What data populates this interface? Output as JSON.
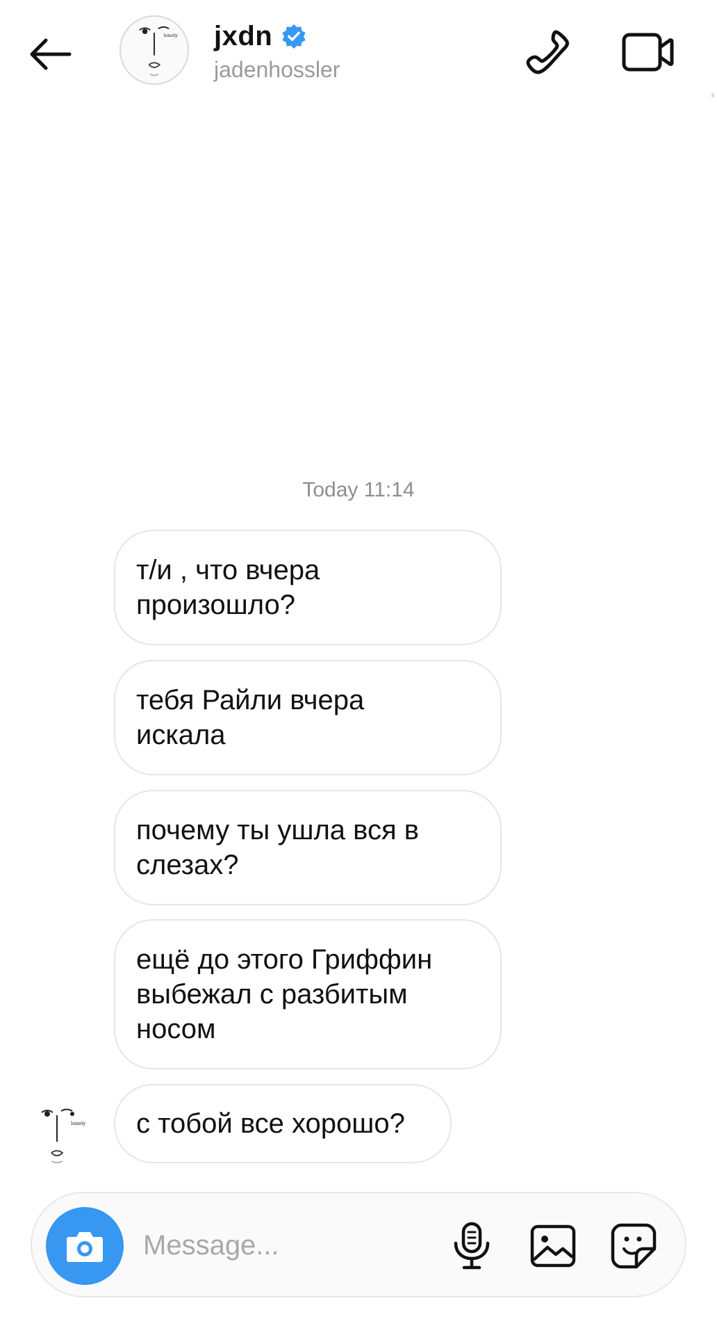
{
  "header": {
    "display_name": "jxdn",
    "username": "jadenhossler",
    "verified": true,
    "back_icon": "arrow-left-icon",
    "call_icon": "phone-icon",
    "video_icon": "video-camera-icon",
    "avatar_caption": "lonely"
  },
  "conversation": {
    "timestamp": "Today 11:14",
    "messages": [
      {
        "text_lines": [
          "т/и , что вчера",
          "произошло?"
        ]
      },
      {
        "text_lines": [
          "тебя Райли вчера",
          "искала"
        ]
      },
      {
        "text_lines": [
          "почему ты ушла вся в",
          "слезах?"
        ]
      },
      {
        "text_lines": [
          "ещё до этого Гриффин",
          "выбежал с разбитым",
          "носом"
        ]
      },
      {
        "text_lines": [
          "с тобой все хорошо?"
        ]
      }
    ]
  },
  "composer": {
    "placeholder": "Message...",
    "value": "",
    "camera_icon": "camera-icon",
    "mic_icon": "microphone-icon",
    "gallery_icon": "image-icon",
    "sticker_icon": "sticker-icon"
  },
  "colors": {
    "accent": "#3897f0",
    "bubble_border": "#e6e6e6",
    "muted_text": "#8e8e8e"
  }
}
